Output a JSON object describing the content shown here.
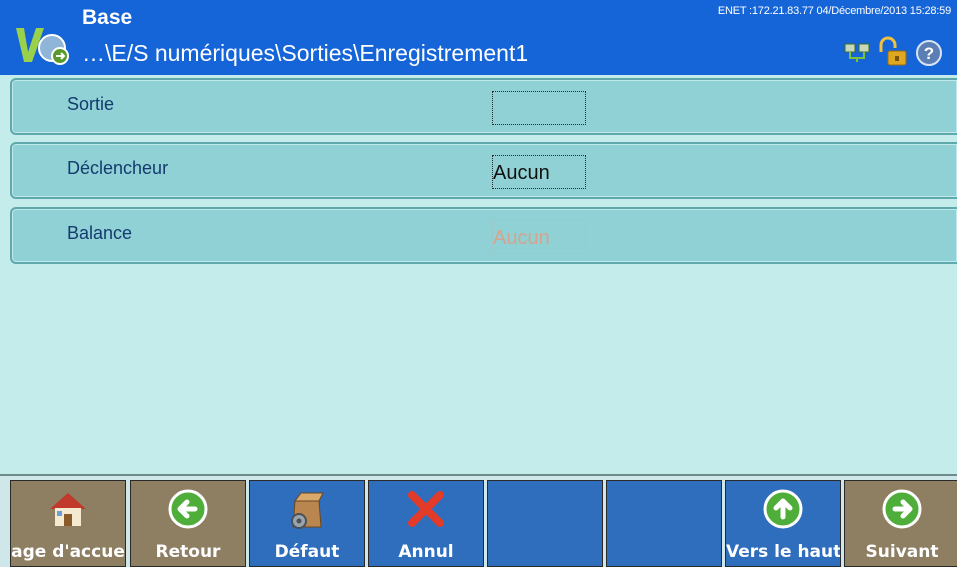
{
  "header": {
    "title": "Base",
    "path": "…\\E/S numériques\\Sorties\\Enregistrement1",
    "status": "ENET :172.21.83.77  04/Décembre/2013 15:28:59",
    "icons": [
      "network-icon",
      "unlocked-padlock-icon",
      "help-icon"
    ]
  },
  "rows": [
    {
      "label": "Sortie",
      "value": ""
    },
    {
      "label": "Déclencheur",
      "value": "Aucun"
    },
    {
      "label": "Balance",
      "value": "Aucun",
      "disabled": true
    }
  ],
  "softkeys": [
    {
      "label": "age d'accue",
      "icon": "home-icon",
      "color": "brown"
    },
    {
      "label": "Retour",
      "icon": "arrow-left-icon",
      "color": "brown"
    },
    {
      "label": "Défaut",
      "icon": "box-gear-icon",
      "color": "blue"
    },
    {
      "label": "Annul",
      "icon": "red-x-icon",
      "color": "blue"
    },
    {
      "label": "",
      "color": "blue"
    },
    {
      "label": "",
      "color": "blue"
    },
    {
      "label": "Vers le haut",
      "icon": "arrow-up-icon",
      "color": "blue"
    },
    {
      "label": "Suivant",
      "icon": "arrow-right-icon",
      "color": "brown"
    }
  ],
  "colors": {
    "header": "#1565d8",
    "row": "#8fd1d4",
    "background": "#c4ecea",
    "softkey_brown": "#8e7f63",
    "softkey_blue": "#2f6dbd"
  }
}
